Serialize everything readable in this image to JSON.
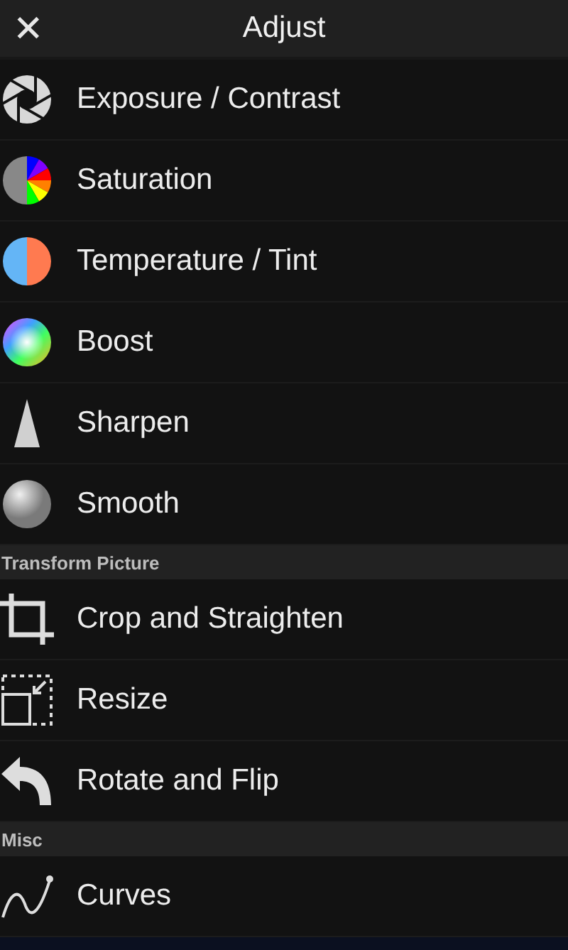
{
  "header": {
    "close": "✕",
    "title": "Adjust"
  },
  "sections": [
    {
      "items": [
        {
          "label": "Exposure / Contrast",
          "kind": "aperture"
        },
        {
          "label": "Saturation",
          "kind": "saturation"
        },
        {
          "label": "Temperature / Tint",
          "kind": "temperature"
        },
        {
          "label": "Boost",
          "kind": "boost"
        },
        {
          "label": "Sharpen",
          "kind": "sharpen"
        },
        {
          "label": "Smooth",
          "kind": "smooth"
        }
      ]
    },
    {
      "title": "Transform Picture",
      "items": [
        {
          "label": "Crop and Straighten",
          "kind": "crop"
        },
        {
          "label": "Resize",
          "kind": "resize"
        },
        {
          "label": "Rotate and Flip",
          "kind": "rotate"
        }
      ]
    },
    {
      "title": "Misc",
      "items": [
        {
          "label": "Curves",
          "kind": "curves"
        }
      ]
    }
  ]
}
